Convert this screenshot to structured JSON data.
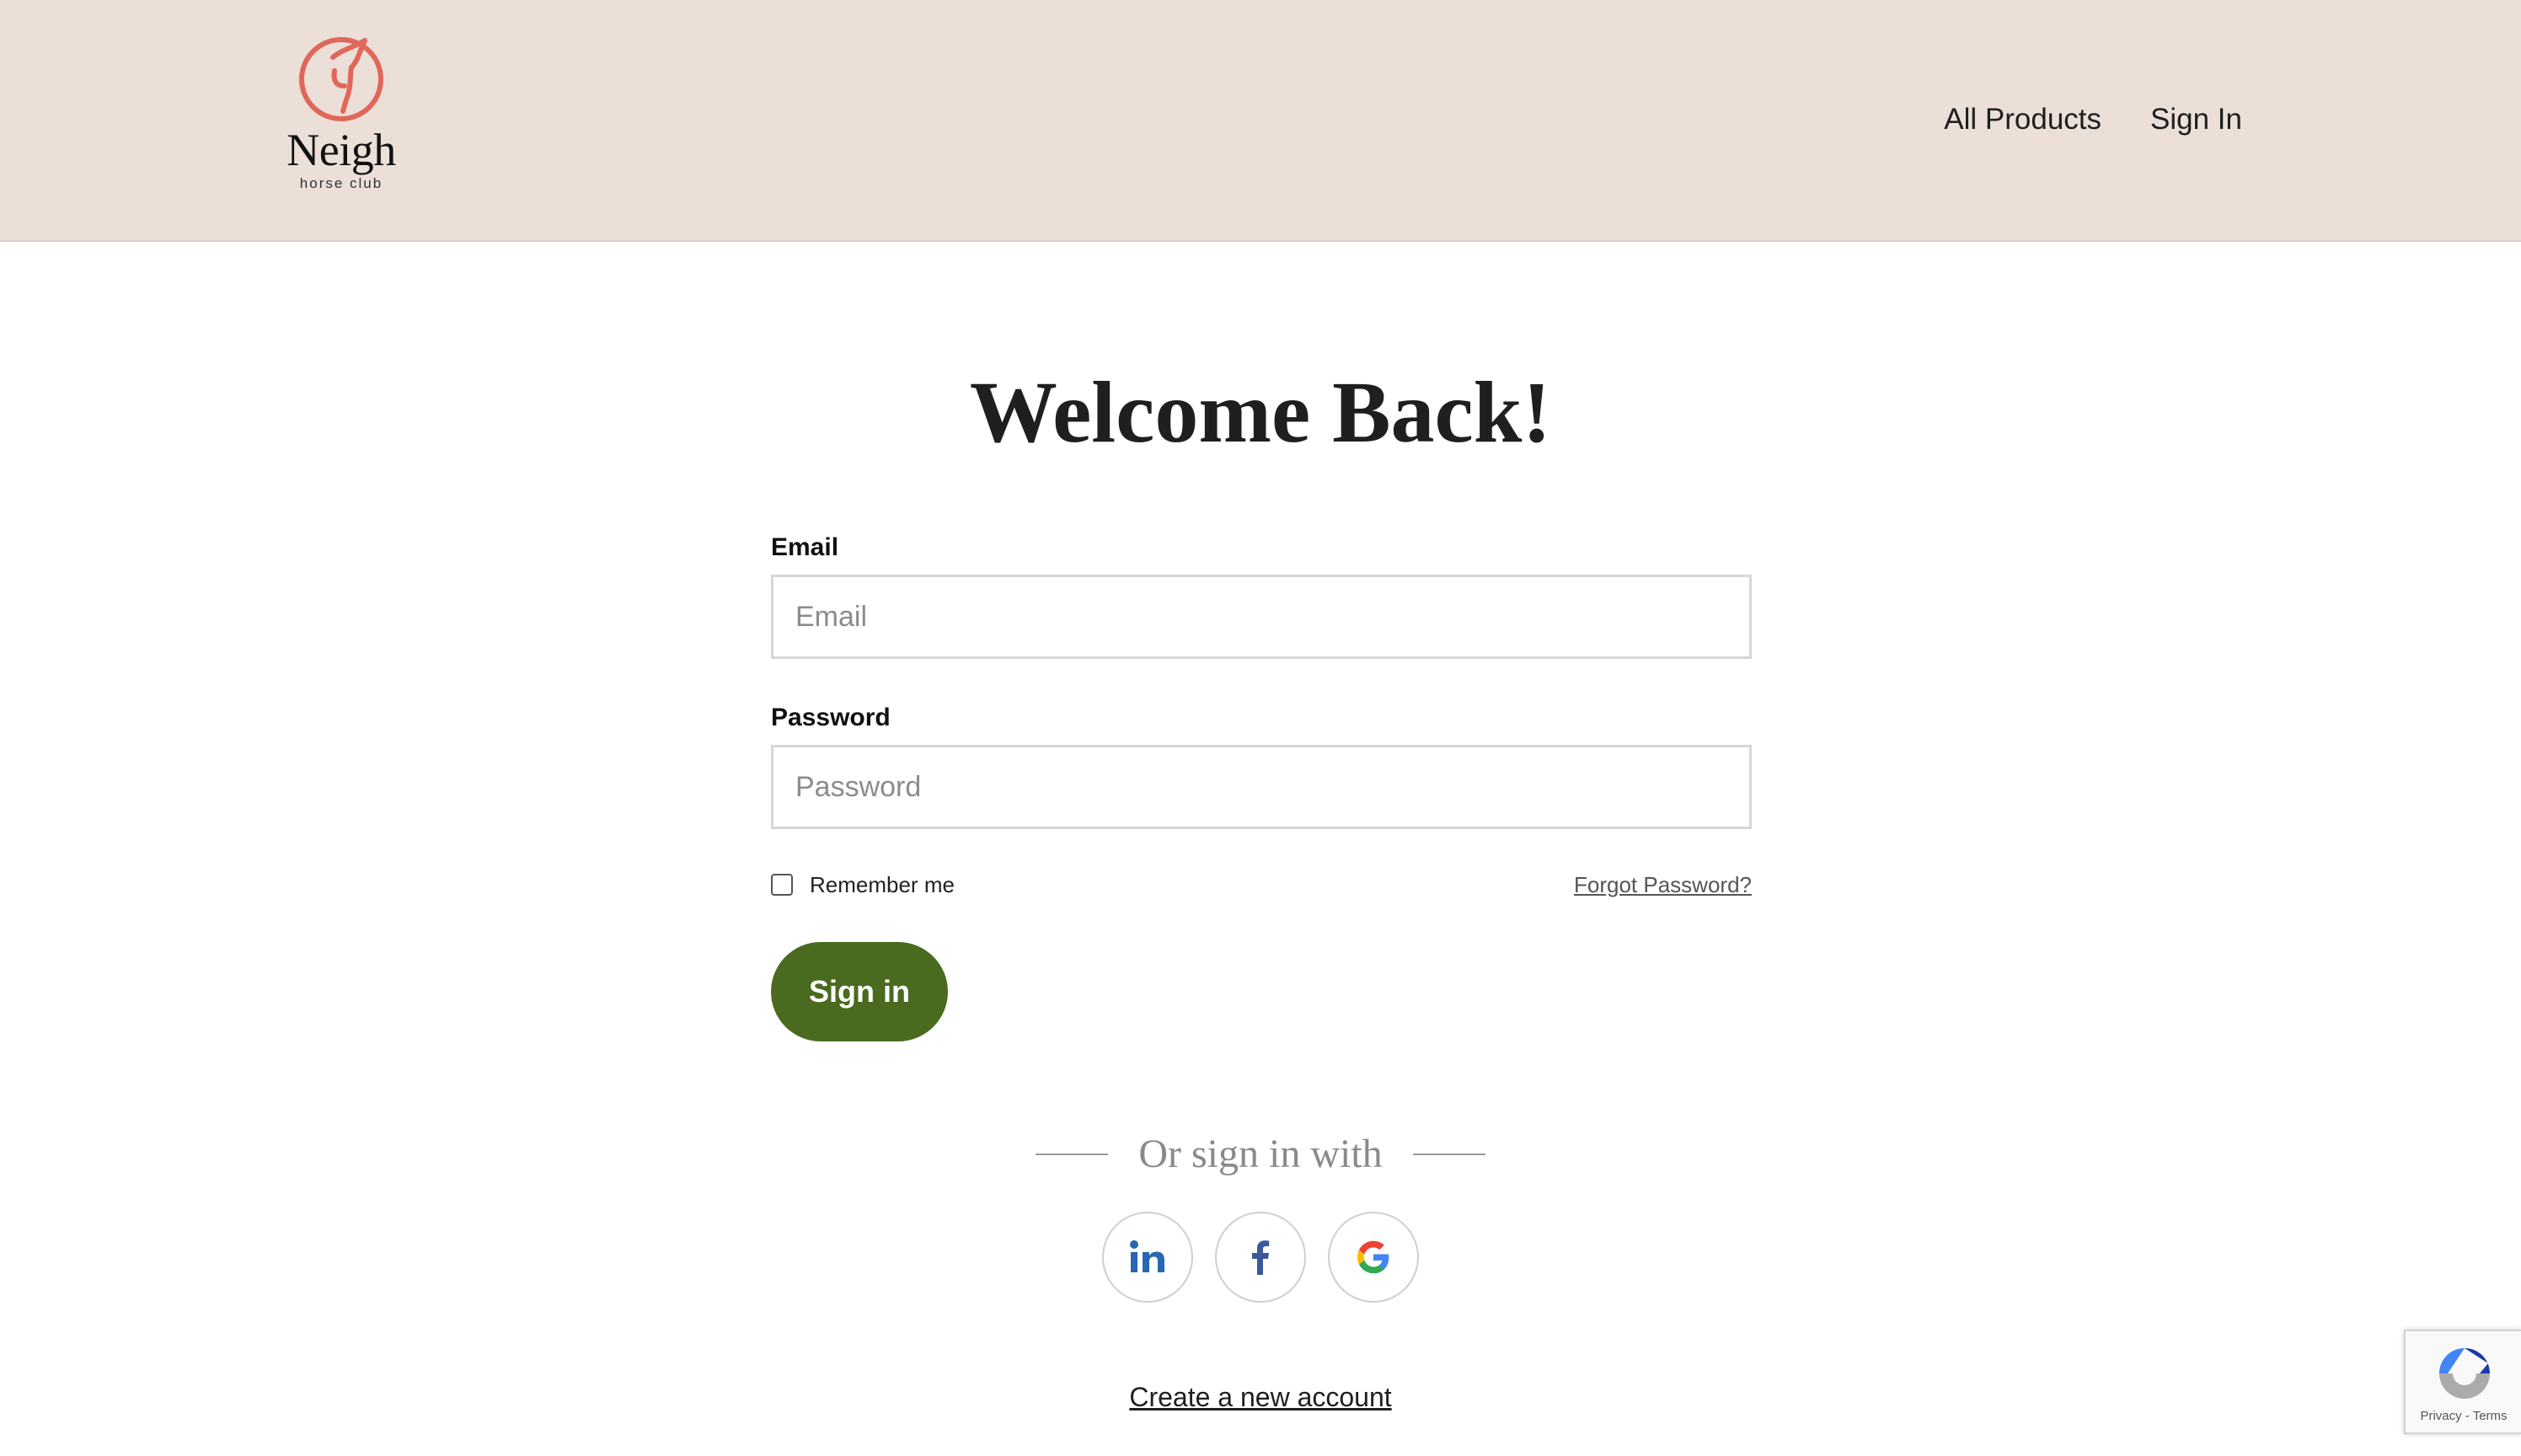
{
  "header": {
    "brand_name": "Neigh",
    "brand_tagline": "horse club",
    "nav": [
      {
        "label": "All Products"
      },
      {
        "label": "Sign In"
      }
    ]
  },
  "page": {
    "title": "Welcome Back!"
  },
  "form": {
    "email_label": "Email",
    "email_placeholder": "Email",
    "email_value": "",
    "password_label": "Password",
    "password_placeholder": "Password",
    "password_value": "",
    "remember_label": "Remember me",
    "remember_checked": false,
    "forgot_label": "Forgot Password?",
    "submit_label": "Sign in"
  },
  "social": {
    "divider_text": "Or sign in with",
    "providers": [
      {
        "icon": "linkedin-icon"
      },
      {
        "icon": "facebook-icon"
      },
      {
        "icon": "google-icon"
      }
    ]
  },
  "footer": {
    "create_account_label": "Create a new account"
  },
  "recaptcha": {
    "privacy_label": "Privacy",
    "separator": "-",
    "terms_label": "Terms"
  },
  "colors": {
    "header_bg": "#ebdfd8",
    "brand_accent": "#e0675a",
    "primary_button": "#4a6b1f",
    "linkedin": "#2867b2",
    "facebook": "#3b5998"
  }
}
